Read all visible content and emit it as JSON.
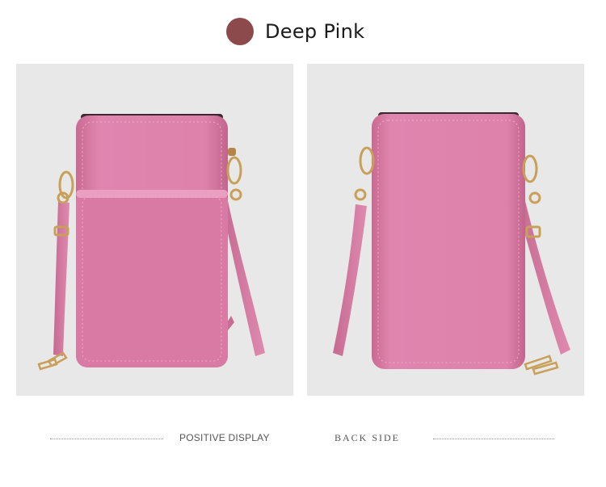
{
  "color_option": {
    "label": "Deep Pink",
    "swatch_color": "#8c4a4c"
  },
  "panels": [
    {
      "view": "front",
      "caption": "POSITIVE DISPLAY"
    },
    {
      "view": "back",
      "caption": "BACK SIDE"
    }
  ],
  "colors": {
    "bag_pink": "#d97aa5",
    "hardware_gold": "#c9a05a",
    "panel_background": "#e8e8e8"
  }
}
